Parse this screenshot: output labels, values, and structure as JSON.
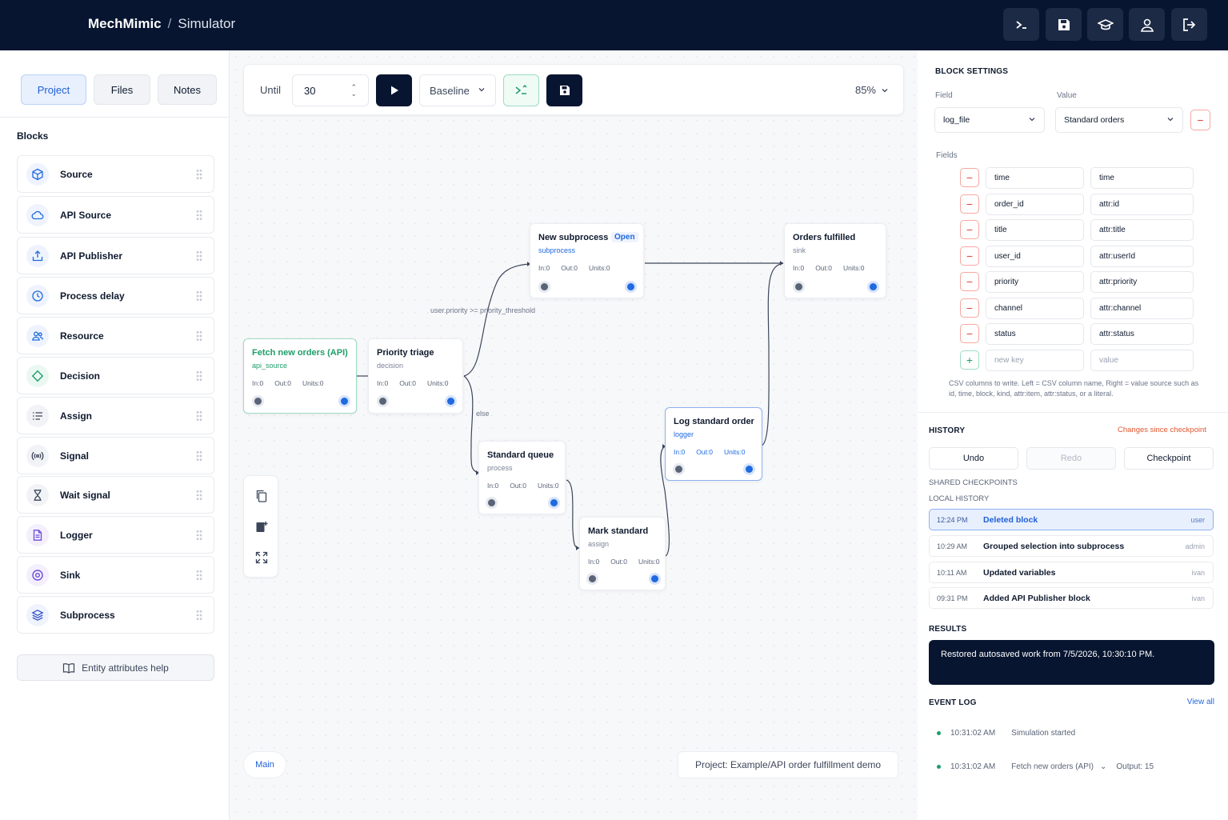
{
  "header": {
    "app_name": "MechMimic",
    "separator": "/",
    "page": "Simulator"
  },
  "left": {
    "tabs": [
      "Project",
      "Files",
      "Notes"
    ],
    "blocks_title": "Blocks",
    "blocks": [
      "Source",
      "API Source",
      "API Publisher",
      "Process delay",
      "Resource",
      "Decision",
      "Assign",
      "Signal",
      "Wait signal",
      "Logger",
      "Sink",
      "Subprocess"
    ],
    "help_button": "Entity attributes help"
  },
  "toolbar": {
    "until_label": "Until",
    "until_value": "30",
    "scenario": "Baseline",
    "zoom": "85%"
  },
  "nodes": {
    "fetch": {
      "title": "Fetch new orders (API)",
      "kind": "api_source",
      "in": "In:0",
      "out": "Out:0",
      "units": "Units:0"
    },
    "triage": {
      "title": "Priority triage",
      "kind": "decision",
      "in": "In:0",
      "out": "Out:0",
      "units": "Units:0"
    },
    "subprocess": {
      "title": "New subprocess",
      "open": "Open",
      "kind": "subprocess",
      "in": "In:0",
      "out": "Out:0",
      "units": "Units:0"
    },
    "fulfilled": {
      "title": "Orders fulfilled",
      "kind": "sink",
      "in": "In:0",
      "out": "Out:0",
      "units": "Units:0"
    },
    "queue": {
      "title": "Standard queue",
      "kind": "process",
      "in": "In:0",
      "out": "Out:0",
      "units": "Units:0"
    },
    "mark": {
      "title": "Mark standard",
      "kind": "assign",
      "in": "In:0",
      "out": "Out:0",
      "units": "Units:0"
    },
    "log": {
      "title": "Log standard order",
      "kind": "logger",
      "in": "In:0",
      "out": "Out:0",
      "units": "Units:0"
    }
  },
  "edge_labels": {
    "priority": "user.priority >= priority_threshold",
    "else": "else"
  },
  "canvas": {
    "main_tab": "Main",
    "project_path": "Project: Example/API order fulfillment demo"
  },
  "settings": {
    "title": "BLOCK SETTINGS",
    "field_label": "Field",
    "value_label": "Value",
    "field_value": "log_file",
    "value_value": "Standard orders",
    "fields_label": "Fields",
    "fields": [
      {
        "key": "time",
        "value": "time"
      },
      {
        "key": "order_id",
        "value": "attr:id"
      },
      {
        "key": "title",
        "value": "attr:title"
      },
      {
        "key": "user_id",
        "value": "attr:userId"
      },
      {
        "key": "priority",
        "value": "attr:priority"
      },
      {
        "key": "channel",
        "value": "attr:channel"
      },
      {
        "key": "status",
        "value": "attr:status"
      }
    ],
    "new_key_placeholder": "new key",
    "new_value_placeholder": "value",
    "help": "CSV columns to write. Left = CSV column name, Right = value source such as id, time, block, kind, attr:item, attr:status, or a literal."
  },
  "history": {
    "title": "HISTORY",
    "changes": "Changes since checkpoint",
    "undo": "Undo",
    "redo": "Redo",
    "checkpoint": "Checkpoint",
    "shared_label": "SHARED CHECKPOINTS",
    "local_label": "LOCAL HISTORY",
    "items": [
      {
        "time": "12:24 PM",
        "desc": "Deleted block",
        "user": "user"
      },
      {
        "time": "10:29 AM",
        "desc": "Grouped selection into subprocess",
        "user": "admin"
      },
      {
        "time": "10:11 AM",
        "desc": "Updated variables",
        "user": "ivan"
      },
      {
        "time": "09:31 PM",
        "desc": "Added API Publisher block",
        "user": "ivan"
      }
    ]
  },
  "results": {
    "title": "RESULTS",
    "message": "Restored autosaved work from 7/5/2026, 10:30:10 PM."
  },
  "event_log": {
    "title": "EVENT LOG",
    "view_all": "View all",
    "events": [
      {
        "time": "10:31:02 AM",
        "text": "Simulation started",
        "extra": ""
      },
      {
        "time": "10:31:02 AM",
        "text": "Fetch new orders (API)",
        "extra": "Output: 15"
      }
    ]
  },
  "colors": {
    "navy": "#071530",
    "blue": "#1f6ae0",
    "green": "#1e9e6a",
    "red": "#e04434"
  }
}
